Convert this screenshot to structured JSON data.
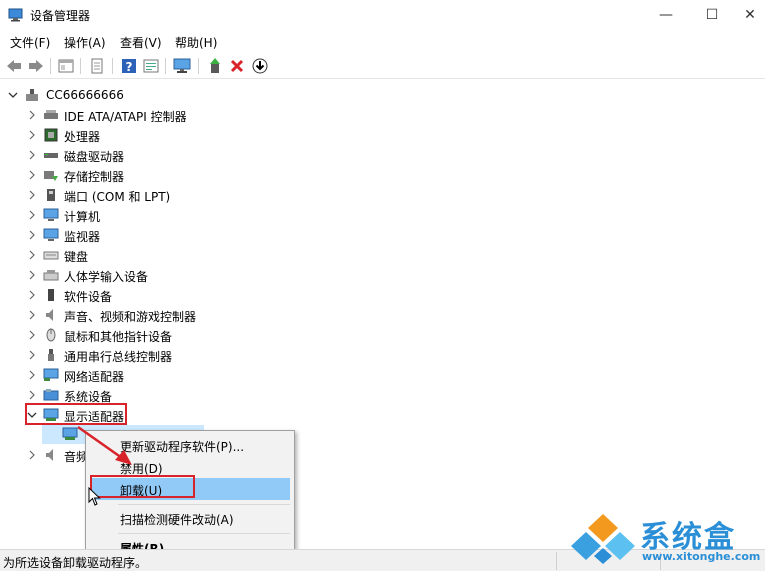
{
  "window": {
    "title": "设备管理器",
    "minimize": "—",
    "maximize": "☐",
    "close": "✕"
  },
  "menu": [
    {
      "label": "文件(F)"
    },
    {
      "label": "操作(A)"
    },
    {
      "label": "查看(V)"
    },
    {
      "label": "帮助(H)"
    }
  ],
  "toolbar": {
    "icons": [
      "back-arrow-icon",
      "forward-arrow-icon",
      "properties-panel-icon",
      "document-icon",
      "help-icon",
      "show-hidden-icon",
      "monitor-scan-icon",
      "update-driver-icon",
      "uninstall-x-icon",
      "download-circle-icon"
    ],
    "uninstall_color": "#d8232a"
  },
  "tree": {
    "root": "CC66666666",
    "categories": [
      {
        "label": "IDE ATA/ATAPI 控制器",
        "icon": "ide-controller-icon"
      },
      {
        "label": "处理器",
        "icon": "processor-icon"
      },
      {
        "label": "磁盘驱动器",
        "icon": "disk-drive-icon"
      },
      {
        "label": "存储控制器",
        "icon": "storage-controller-icon"
      },
      {
        "label": "端口 (COM 和 LPT)",
        "icon": "port-icon"
      },
      {
        "label": "计算机",
        "icon": "computer-icon"
      },
      {
        "label": "监视器",
        "icon": "monitor-icon"
      },
      {
        "label": "键盘",
        "icon": "keyboard-icon"
      },
      {
        "label": "人体学输入设备",
        "icon": "hid-icon"
      },
      {
        "label": "软件设备",
        "icon": "software-device-icon"
      },
      {
        "label": "声音、视频和游戏控制器",
        "icon": "speaker-icon"
      },
      {
        "label": "鼠标和其他指针设备",
        "icon": "mouse-icon"
      },
      {
        "label": "通用串行总线控制器",
        "icon": "usb-icon"
      },
      {
        "label": "网络适配器",
        "icon": "network-adapter-icon"
      },
      {
        "label": "系统设备",
        "icon": "system-device-icon"
      },
      {
        "label": "显示适配器",
        "icon": "display-adapter-icon"
      }
    ],
    "partial_label": "音频"
  },
  "context_menu": [
    {
      "label": "更新驱动程序软件(P)..."
    },
    {
      "label": "禁用(D)"
    },
    {
      "label": "卸载(U)"
    },
    {
      "label": "扫描检测硬件改动(A)"
    },
    {
      "label": "属性(R)"
    }
  ],
  "status": {
    "text": "为所选设备卸载驱动程序。"
  },
  "watermark": {
    "name": "系统盒",
    "url": "www.xitonghe.com"
  },
  "colors": {
    "highlight_red": "#d8232a",
    "selection_blue": "#cce8ff",
    "hover_blue": "#91c9f7",
    "watermark_blue": "#2a8fd6"
  }
}
